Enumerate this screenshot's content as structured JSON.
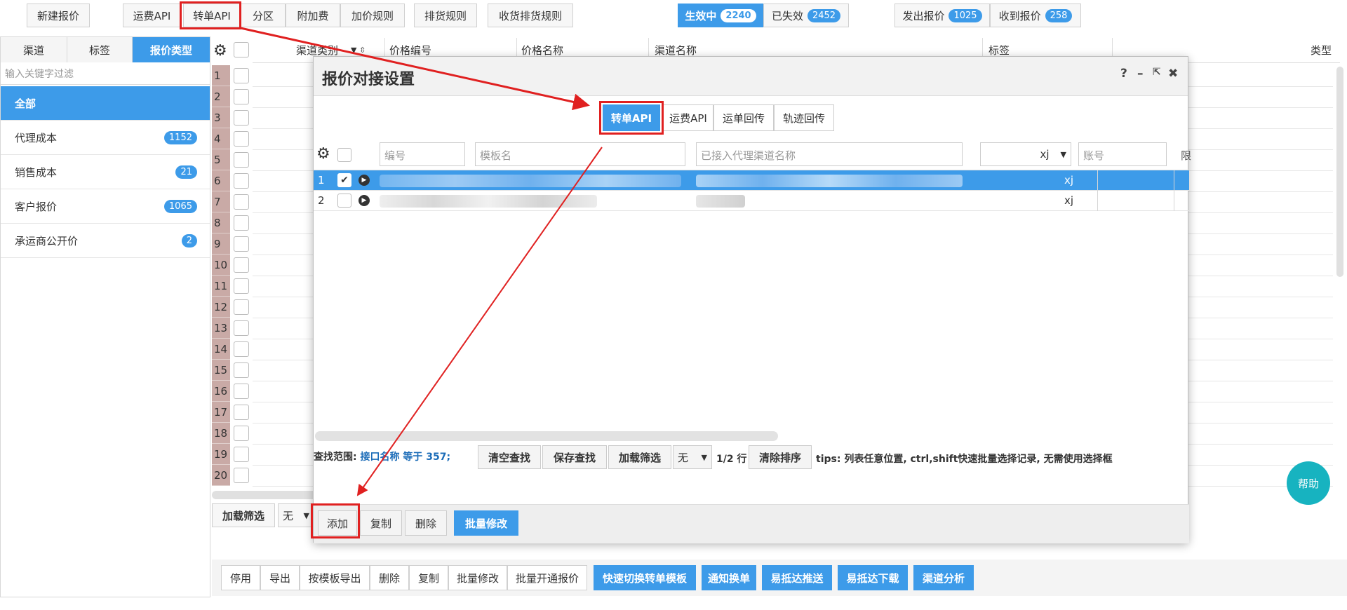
{
  "toolbar": {
    "new_quote": "新建报价",
    "freight_api": "运费API",
    "transfer_api": "转单API",
    "zone": "分区",
    "surcharge": "附加费",
    "markup_rule": "加价规则",
    "cargo_rule": "排货规则",
    "receive_rule": "收货排货规则",
    "active": {
      "label": "生效中",
      "count": "2240"
    },
    "expired": {
      "label": "已失效",
      "count": "2452"
    },
    "sent": {
      "label": "发出报价",
      "count": "1025"
    },
    "received": {
      "label": "收到报价",
      "count": "258"
    }
  },
  "left_panel": {
    "tabs": [
      "渠道",
      "标签",
      "报价类型"
    ],
    "filter_placeholder": "输入关键字过滤",
    "items": [
      {
        "label": "全部",
        "count": ""
      },
      {
        "label": "代理成本",
        "count": "1152"
      },
      {
        "label": "销售成本",
        "count": "21"
      },
      {
        "label": "客户报价",
        "count": "1065"
      },
      {
        "label": "承运商公开价",
        "count": "2"
      }
    ]
  },
  "grid": {
    "headers": [
      "渠道类别",
      "价格编号",
      "价格名称",
      "渠道名称",
      "标签",
      "类型"
    ],
    "row_numbers": [
      "1",
      "2",
      "3",
      "4",
      "5",
      "6",
      "7",
      "8",
      "9",
      "10",
      "11",
      "12",
      "13",
      "14",
      "15",
      "16",
      "17",
      "18",
      "19",
      "20"
    ],
    "load_filter": "加载筛选",
    "none_option": "无"
  },
  "modal": {
    "title": "报价对接设置",
    "controls": [
      "?",
      "–",
      "⇱",
      "✖"
    ],
    "tabs": [
      "转单API",
      "运费API",
      "运单回传",
      "轨迹回传"
    ],
    "filters": {
      "number": "编号",
      "template": "模板名",
      "channel": "已接入代理渠道名称",
      "xj": "xj",
      "account": "账号",
      "limit": "限"
    },
    "rows": [
      {
        "num": "1",
        "xj": "xj"
      },
      {
        "num": "2",
        "xj": "xj"
      }
    ],
    "search_label": "查找范围:",
    "search_value": "接口名称 等于 357;",
    "clear_search": "清空查找",
    "save_search": "保存查找",
    "load_filter": "加载筛选",
    "none_option": "无",
    "page_info": "1/2 行",
    "clear_sort": "清除排序",
    "tips": "tips: 列表任意位置, ctrl,shift快速批量选择记录, 无需使用选择框",
    "add": "添加",
    "copy": "复制",
    "delete": "删除",
    "batch_edit": "批量修改"
  },
  "help": "帮助",
  "bottom_bar": {
    "buttons": [
      "停用",
      "导出",
      "按模板导出",
      "删除",
      "复制",
      "批量修改",
      "批量开通报价"
    ],
    "blue_buttons": [
      "快速切换转单模板",
      "通知换单",
      "易抵达推送",
      "易抵达下载",
      "渠道分析"
    ]
  },
  "colors": {
    "accent": "#3d9be9",
    "annotation": "#e02020",
    "help_bg": "#17b3c0"
  }
}
